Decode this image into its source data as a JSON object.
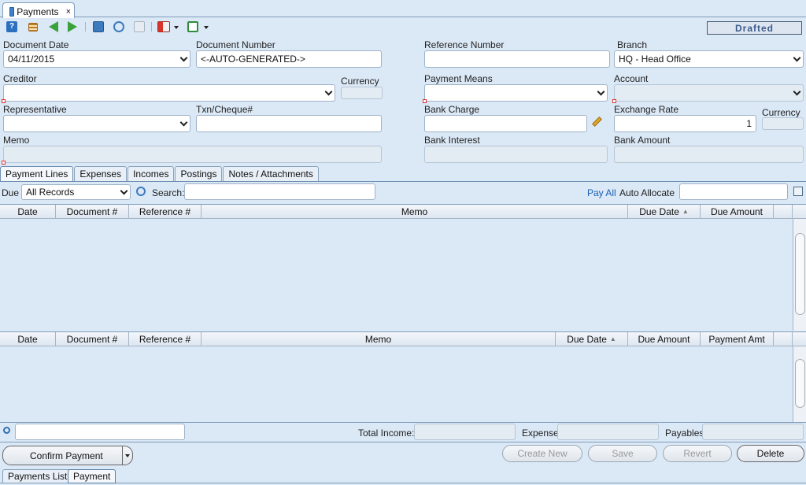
{
  "window": {
    "tab_label": "Payments"
  },
  "status": {
    "text": "Drafted"
  },
  "form": {
    "document_date": {
      "label": "Document Date",
      "value": "04/11/2015"
    },
    "document_number": {
      "label": "Document Number",
      "value": "<-AUTO-GENERATED->"
    },
    "reference_number": {
      "label": "Reference Number",
      "value": ""
    },
    "branch": {
      "label": "Branch",
      "value": "HQ - Head Office"
    },
    "creditor": {
      "label": "Creditor",
      "value": ""
    },
    "currency_1": {
      "label": "Currency",
      "value": ""
    },
    "payment_means": {
      "label": "Payment Means",
      "value": ""
    },
    "account": {
      "label": "Account",
      "value": ""
    },
    "representative": {
      "label": "Representative",
      "value": ""
    },
    "txn_cheque": {
      "label": "Txn/Cheque#",
      "value": ""
    },
    "bank_charge": {
      "label": "Bank Charge",
      "value": ""
    },
    "exchange_rate": {
      "label": "Exchange Rate",
      "value": "1"
    },
    "currency_2": {
      "label": "Currency",
      "value": ""
    },
    "memo": {
      "label": "Memo",
      "value": ""
    },
    "bank_interest": {
      "label": "Bank Interest",
      "value": ""
    },
    "bank_amount": {
      "label": "Bank Amount",
      "value": ""
    }
  },
  "tabs": [
    "Payment Lines",
    "Expenses",
    "Incomes",
    "Postings",
    "Notes / Attachments"
  ],
  "filter": {
    "due_label": "Due",
    "due_value": "All Records",
    "search_label": "Search:",
    "pay_all": "Pay All",
    "auto_allocate_label": "Auto Allocate"
  },
  "grid1": {
    "columns": [
      "Date",
      "Document #",
      "Reference #",
      "Memo",
      "Due Date",
      "Due Amount"
    ]
  },
  "grid2": {
    "columns": [
      "Date",
      "Document #",
      "Reference #",
      "Memo",
      "Due Date",
      "Due Amount",
      "Payment Amt"
    ]
  },
  "sort_indicator": "▲",
  "totals": {
    "income_label": "Total Income:",
    "expense_label": "Expense:",
    "payables_label": "Payables:"
  },
  "actions": {
    "confirm": "Confirm Payment",
    "create_new": "Create New",
    "save": "Save",
    "revert": "Revert",
    "delete": "Delete"
  },
  "bottom_tabs": [
    "Payments List",
    "Payment"
  ],
  "colors": {
    "accent": "#1a5fb4",
    "background": "#dbe8f6"
  }
}
